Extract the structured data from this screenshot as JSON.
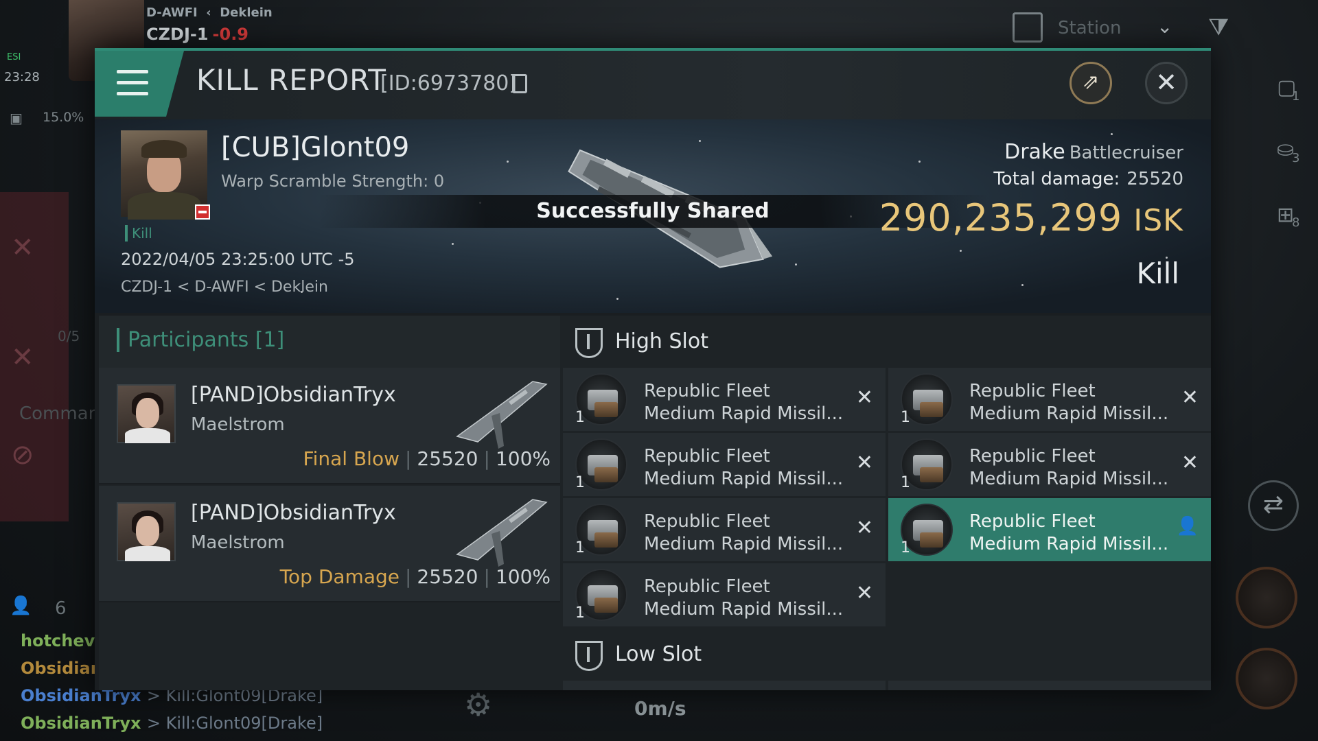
{
  "hud": {
    "system_path_a": "D-AWFI",
    "system_path_b": "Deklein",
    "system_name": "CZDJ-1",
    "system_security": "-0.9",
    "time": "23:28",
    "signal": "ESI",
    "cargo_percent": "15.0%",
    "station_label": "Station",
    "commander": "Comman",
    "slots_label": "0/5",
    "chat_user_count": "6",
    "right_counts": [
      "1",
      "3",
      "8"
    ],
    "speed": "0m/s",
    "chat": [
      {
        "user": "hotchevy",
        "text": "",
        "color": "#7fb05a"
      },
      {
        "user": "Obsidian",
        "text": "",
        "color": "#b38a3c"
      },
      {
        "user": "ObsidianTryx",
        "text": "> Kill:Glont09[Drake]",
        "color": "#4a7fcf"
      },
      {
        "user": "ObsidianTryx",
        "text": "> Kill:Glont09[Drake]",
        "color": "#7fb05a"
      }
    ]
  },
  "report": {
    "title": "KILL REPORT",
    "id": "[ID:6973780]",
    "victim": {
      "name": "[CUB]Glont09",
      "warp_scramble": "Warp Scramble Strength: 0",
      "kill_tag": "Kill",
      "date": "2022/04/05 23:25:00 UTC -5",
      "location": "CZDJ-1 < D-AWFI < Deklein"
    },
    "toast": "Successfully Shared",
    "ship": {
      "name": "Drake",
      "class": "Battlecruiser",
      "total_damage_label": "Total damage:",
      "total_damage": "25520",
      "isk_value": "290,235,299",
      "isk_unit": "ISK",
      "result": "Kill"
    },
    "participants": {
      "title": "Participants [1]",
      "items": [
        {
          "name": "[PAND]ObsidianTryx",
          "ship": "Maelstrom",
          "role": "Final Blow",
          "damage": "25520",
          "percent": "100%"
        },
        {
          "name": "[PAND]ObsidianTryx",
          "ship": "Maelstrom",
          "role": "Top Damage",
          "damage": "25520",
          "percent": "100%"
        }
      ]
    },
    "fitting": {
      "high_slot_title": "High Slot",
      "low_slot_title": "Low Slot",
      "modules": [
        {
          "line1": "Republic Fleet",
          "line2": "Medium Rapid Missil...",
          "qty": "1",
          "status": "✕",
          "status_icon": "destroyed-x-icon",
          "active": false
        },
        {
          "line1": "Republic Fleet",
          "line2": "Medium Rapid Missil...",
          "qty": "1",
          "status": "✕",
          "status_icon": "destroyed-x-icon",
          "active": false
        },
        {
          "line1": "Republic Fleet",
          "line2": "Medium Rapid Missil...",
          "qty": "1",
          "status": "✕",
          "status_icon": "destroyed-x-icon",
          "active": false
        },
        {
          "line1": "Republic Fleet",
          "line2": "Medium Rapid Missil...",
          "qty": "1",
          "status": "✕",
          "status_icon": "destroyed-x-icon",
          "active": false
        },
        {
          "line1": "Republic Fleet",
          "line2": "Medium Rapid Missil...",
          "qty": "1",
          "status": "✕",
          "status_icon": "destroyed-x-icon",
          "active": false
        },
        {
          "line1": "Republic Fleet",
          "line2": "Medium Rapid Missil...",
          "qty": "1",
          "status": "👤",
          "status_icon": "dropped-person-icon",
          "active": true
        },
        {
          "line1": "Republic Fleet",
          "line2": "Medium Rapid Missil...",
          "qty": "1",
          "status": "✕",
          "status_icon": "destroyed-x-icon",
          "active": false
        }
      ]
    }
  },
  "colors": {
    "accent": "#2f8a76",
    "isk": "#e8c67a",
    "role": "#d7a64f",
    "security": "#d23a3a"
  }
}
